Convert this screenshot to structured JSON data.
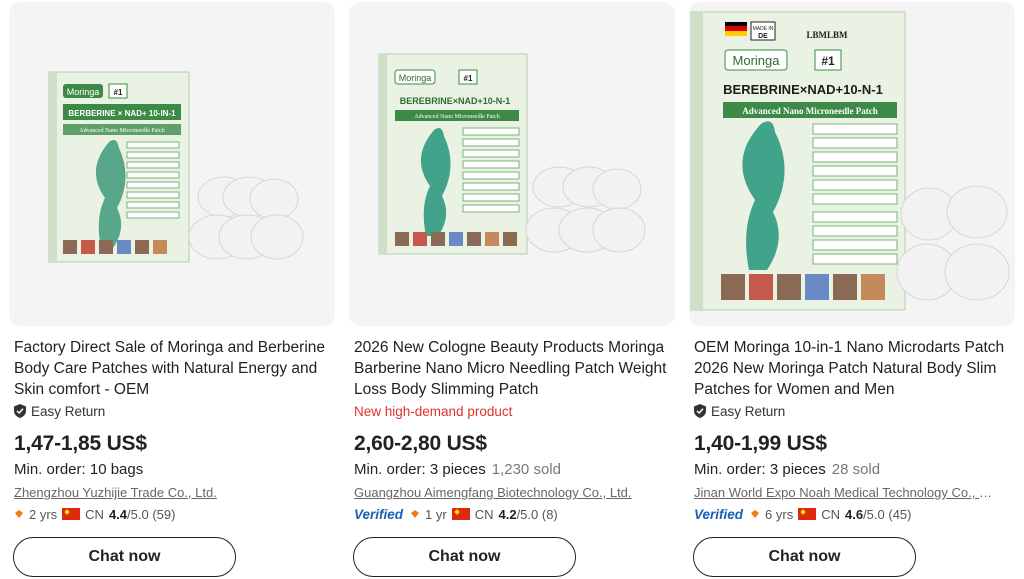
{
  "products": [
    {
      "image": {
        "brand_top": "",
        "variety_label": "Moringa",
        "badge": "#1",
        "product_line": "BERBERINE × NAD+ 10-IN-1",
        "sub_line": "Advanced Nano Microneedle Patch",
        "icon": "product-box-icon"
      },
      "title": "Factory Direct Sale of Moringa and Berberine Body Care Patches with Natural Energy and Skin comfort - OEM",
      "tag": "Easy Return",
      "tag_icon": "shield-check-icon",
      "price": "1,47-1,85 US$",
      "min_order": "Min. order: 10 bags",
      "sold": "",
      "supplier": "Zhengzhou Yuzhijie Trade Co., Ltd.",
      "verified": "",
      "years": "2 yrs",
      "country": "CN",
      "rating": "4.4",
      "rating_max": "/5.0",
      "reviews": "(59)",
      "chat_label": "Chat now"
    },
    {
      "image": {
        "brand_top": "",
        "variety_label": "Moringa",
        "badge": "#1",
        "product_line": "BEREBRINE×NAD+10-N-1",
        "sub_line": "Advanced Nano Microneedle Patch",
        "icon": "product-box-icon"
      },
      "title": "2026 New Cologne Beauty Products Moringa Barberine Nano Micro Needling Patch Weight Loss Body Slimming Patch",
      "tag": "New high-demand product",
      "tag_icon": "",
      "price": "2,60-2,80 US$",
      "min_order": "Min. order: 3 pieces",
      "sold": "1,230 sold",
      "supplier": "Guangzhou Aimengfang Biotechnology Co., Ltd.",
      "verified": "Verified",
      "years": "1 yr",
      "country": "CN",
      "rating": "4.2",
      "rating_max": "/5.0",
      "reviews": "(8)",
      "chat_label": "Chat now"
    },
    {
      "image": {
        "brand_top": "LBMLBM",
        "made_in": "MADE IN DE",
        "variety_label": "Moringa",
        "badge": "#1",
        "product_line": "BEREBRINE×NAD+10-N-1",
        "sub_line": "Advanced Nano Microneedle Patch",
        "icon": "product-box-icon"
      },
      "title": "OEM Moringa 10-in-1 Nano Microdarts Patch 2026 New Moringa Patch Natural Body Slim Patches for Women and Men",
      "tag": "Easy Return",
      "tag_icon": "shield-check-icon",
      "price": "1,40-1,99 US$",
      "min_order": "Min. order: 3 pieces",
      "sold": "28 sold",
      "supplier": "Jinan World Expo Noah Medical Technology Co., Ltd.",
      "verified": "Verified",
      "years": "6 yrs",
      "country": "CN",
      "rating": "4.6",
      "rating_max": "/5.0",
      "reviews": "(45)",
      "chat_label": "Chat now"
    }
  ],
  "colors": {
    "box_green": "#3c8a46",
    "box_light": "#e9f2e3",
    "hot_red": "#e0322b",
    "verified_blue": "#1a5fb4",
    "diamond_orange": "#f07b1a"
  }
}
